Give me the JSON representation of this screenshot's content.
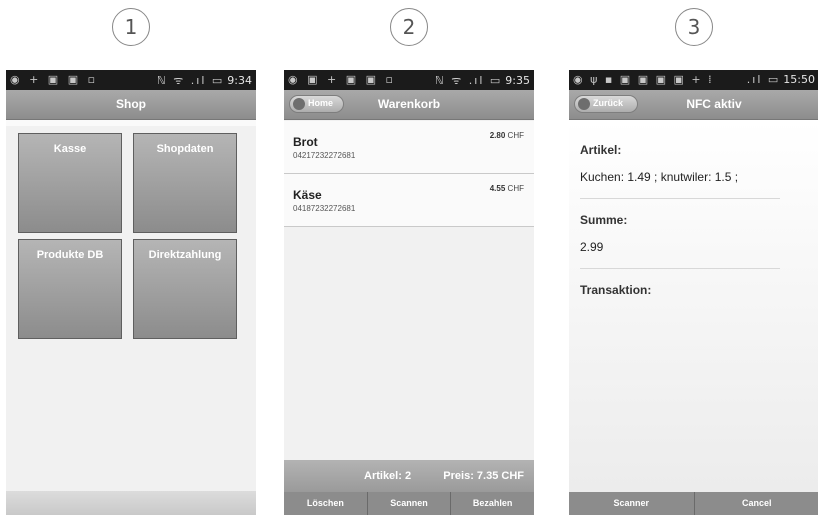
{
  "steps": [
    "1",
    "2",
    "3"
  ],
  "phone1": {
    "status": {
      "left_icons": "◉ + ▣ ▣ ▫",
      "right_icons": "ℕ ᯤ .ıl ▭",
      "time": "9:34"
    },
    "title": "Shop",
    "tiles": [
      "Kasse",
      "Shopdaten",
      "Produkte DB",
      "Direktzahlung"
    ]
  },
  "phone2": {
    "status": {
      "left_icons": "◉ ▣ + ▣ ▣ ▫",
      "right_icons": "ℕ ᯤ .ıl ▭",
      "time": "9:35"
    },
    "title": "Warenkorb",
    "home_label": "Home",
    "items": [
      {
        "name": "Brot",
        "code": "04217232272681",
        "price": "2.80",
        "currency": "CHF"
      },
      {
        "name": "Käse",
        "code": "04187232272681",
        "price": "4.55",
        "currency": "CHF"
      }
    ],
    "footer": {
      "count": "Artikel: 2",
      "total": "Preis: 7.35 CHF"
    },
    "buttons": [
      "Löschen",
      "Scannen",
      "Bezahlen"
    ]
  },
  "phone3": {
    "status": {
      "left_icons": "◉ ψ ▪ ▣ ▣ ▣ ▣ + ⁞",
      "right_icons": ".ıl ▭",
      "time": "15:50"
    },
    "title": "NFC aktiv",
    "back_label": "Zurück",
    "artikel_label": "Artikel:",
    "artikel_value": "Kuchen: 1.49 ; knutwiler: 1.5 ;",
    "summe_label": "Summe:",
    "summe_value": "2.99",
    "transaktion_label": "Transaktion:",
    "buttons": [
      "Scanner",
      "Cancel"
    ]
  }
}
